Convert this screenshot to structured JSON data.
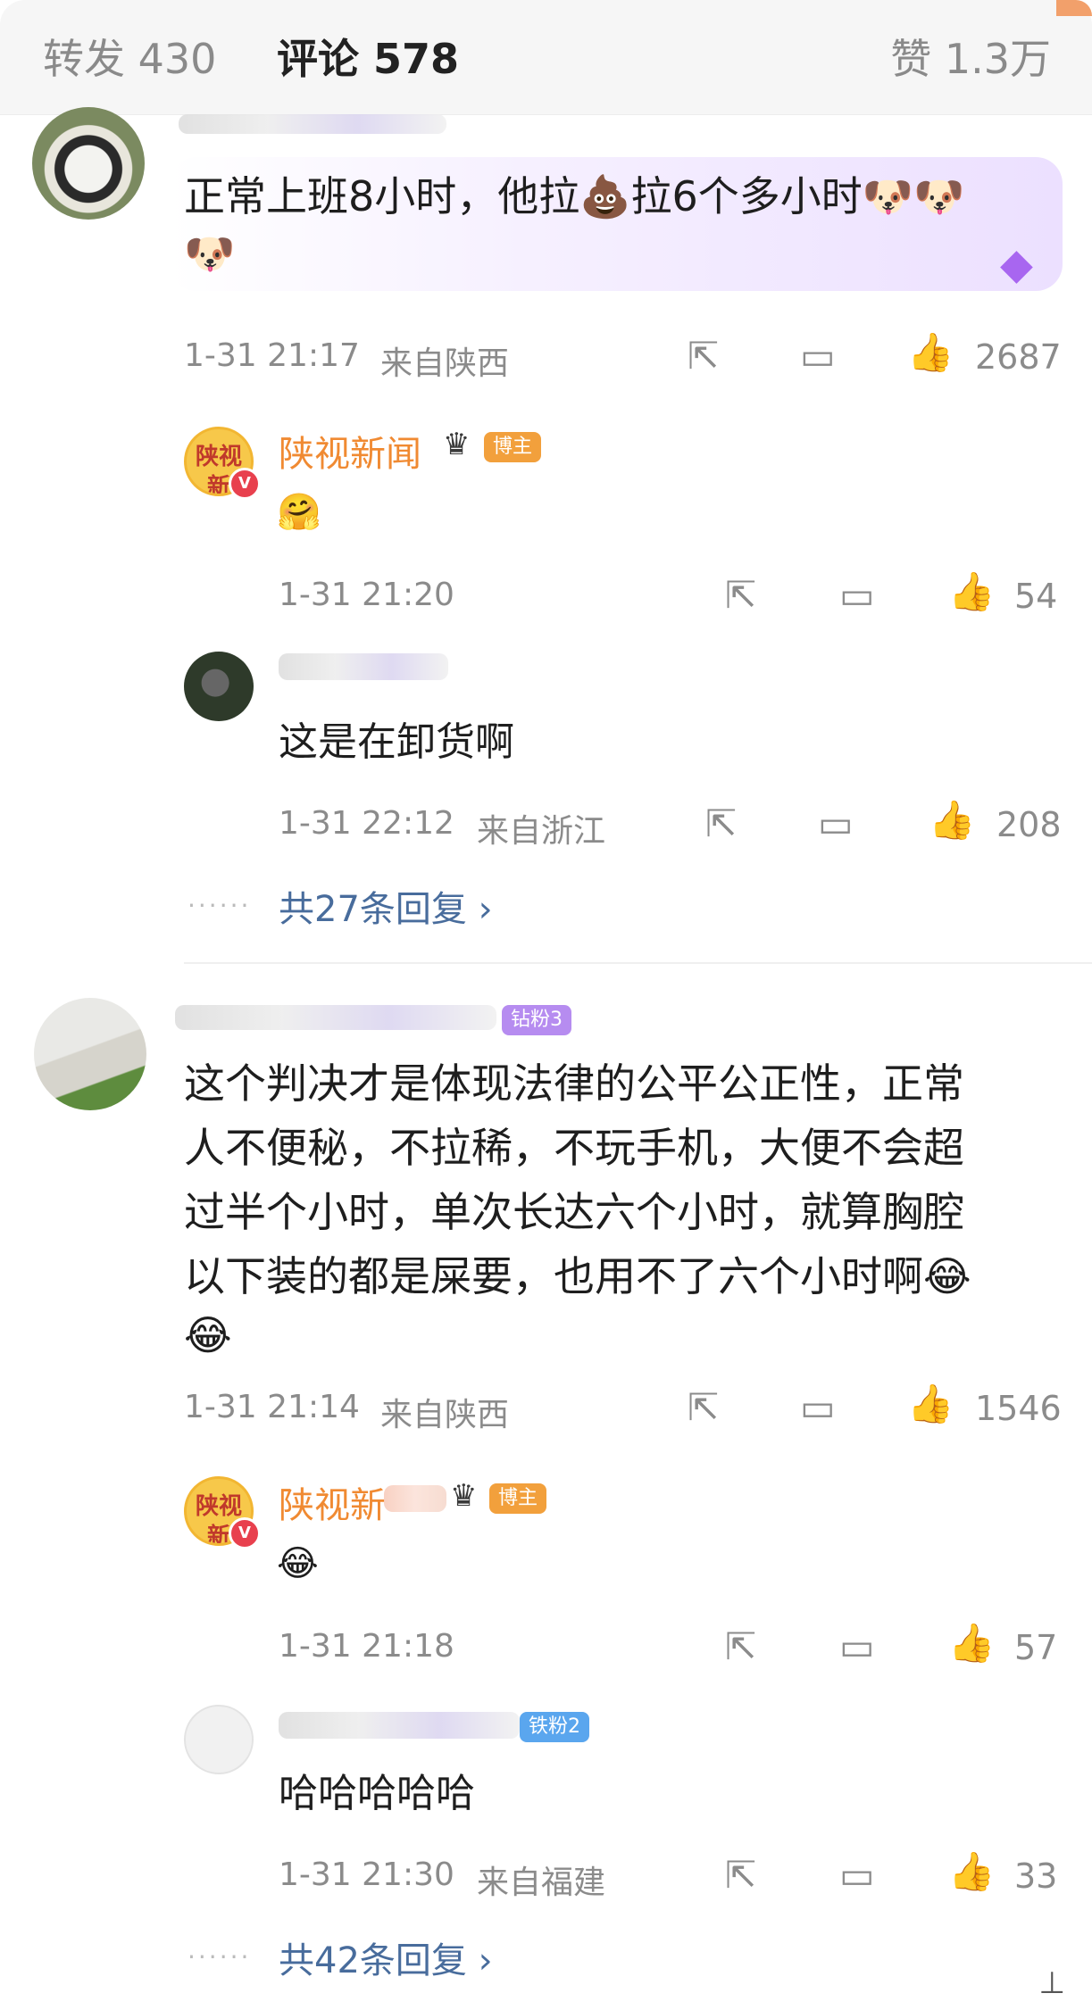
{
  "header": {
    "repost_tab": "转发 430",
    "comments_tab": "评论 578",
    "likes_tab": "赞 1.3万"
  },
  "comments": [
    {
      "avatar_icon": "panda-avatar",
      "text_line1": "正常上班8小时，他拉💩拉6个多小时🐶🐶",
      "text_line2": "🐶",
      "time": "1-31 21:17",
      "location": "来自陕西",
      "likes": "2687",
      "replies": [
        {
          "name": "陕视新闻",
          "tag": "博主",
          "avatar_text": "陕视\n新",
          "text": "🤗",
          "time": "1-31 21:20",
          "location": "",
          "likes": "54"
        },
        {
          "name": "",
          "tag": "",
          "text": "这是在卸货啊",
          "time": "1-31 22:12",
          "location": "来自浙江",
          "likes": "208"
        }
      ],
      "more_replies": "共27条回复 ›"
    },
    {
      "avatar_icon": "couch-avatar",
      "tag": "钻粉3",
      "text_lines": [
        "这个判决才是体现法律的公平公正性，正常",
        "人不便秘，不拉稀，不玩手机，大便不会超",
        "过半个小时，单次长达六个小时，就算胸腔",
        "以下装的都是屎要，也用不了六个小时啊😂",
        "😂"
      ],
      "time": "1-31 21:14",
      "location": "来自陕西",
      "likes": "1546",
      "replies": [
        {
          "name": "陕视新",
          "tag": "博主",
          "avatar_text": "陕视\n新",
          "text": "😂",
          "time": "1-31 21:18",
          "location": "",
          "likes": "57"
        },
        {
          "name": "",
          "tag": "铁粉2",
          "text": "哈哈哈哈哈",
          "time": "1-31 21:30",
          "location": "来自福建",
          "likes": "33"
        }
      ],
      "more_replies": "共42条回复 ›"
    }
  ],
  "icons": {
    "share": "↗",
    "comment": "💬",
    "like": "👍"
  },
  "colors": {
    "username": "#f08a32",
    "more_replies": "#486c9c",
    "meta": "#8b8b8b"
  }
}
